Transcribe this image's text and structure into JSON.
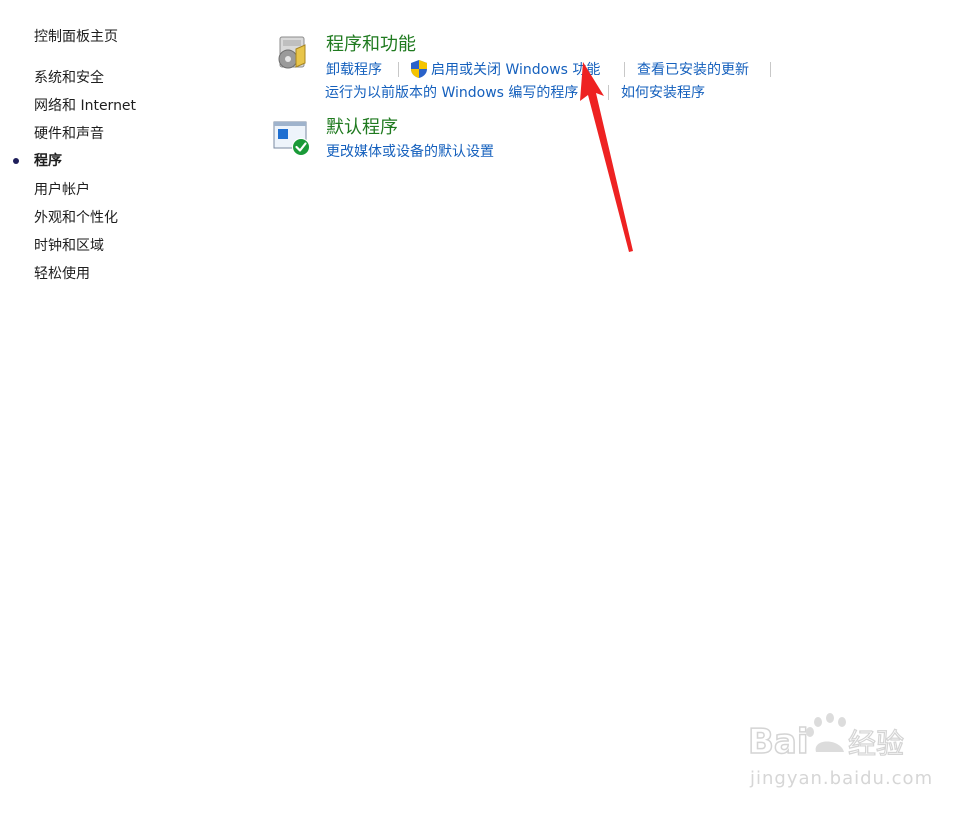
{
  "sidebar": {
    "home": "控制面板主页",
    "items": [
      {
        "label": "系统和安全",
        "active": false
      },
      {
        "label": "网络和 Internet",
        "active": false
      },
      {
        "label": "硬件和声音",
        "active": false
      },
      {
        "label": "程序",
        "active": true
      },
      {
        "label": "用户帐户",
        "active": false
      },
      {
        "label": "外观和个性化",
        "active": false
      },
      {
        "label": "时钟和区域",
        "active": false
      },
      {
        "label": "轻松使用",
        "active": false
      }
    ]
  },
  "main": {
    "programs_features": {
      "title": "程序和功能",
      "links": {
        "uninstall": "卸载程序",
        "windows_features": "启用或关闭 Windows 功能",
        "installed_updates": "查看已安装的更新",
        "compat": "运行为以前版本的 Windows 编写的程序",
        "how_install": "如何安装程序"
      }
    },
    "default_programs": {
      "title": "默认程序",
      "links": {
        "change_defaults": "更改媒体或设备的默认设置"
      }
    }
  },
  "watermark": {
    "brand": "Baidu经验",
    "url": "jingyan.baidu.com"
  },
  "colors": {
    "link": "#1560bd",
    "category_title": "#1f7a1f",
    "annotation_arrow": "#ee2222",
    "shield_blue": "#2a62c9",
    "shield_yellow": "#f5c400",
    "check_green": "#1a9a38"
  },
  "icons": {
    "programs": "programs-features-icon",
    "shield": "uac-shield-icon",
    "defaults": "default-programs-icon"
  }
}
